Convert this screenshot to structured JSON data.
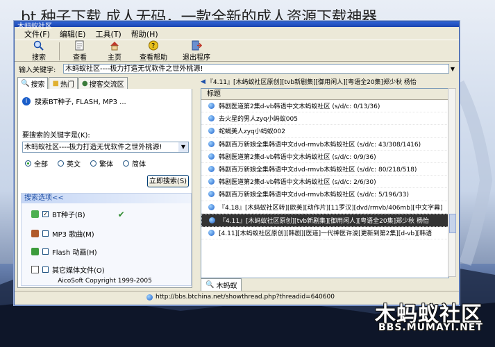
{
  "overlay_title": "bt 种子下载 成人无码，一款全新的成人资源下载神器",
  "window": {
    "title": "木蚂蚁社区"
  },
  "menu": [
    "文件(F)",
    "编辑(E)",
    "工具(T)",
    "帮助(H)"
  ],
  "toolbar": [
    {
      "label": "搜索",
      "icon": "search-icon"
    },
    {
      "label": "查看",
      "icon": "view-icon"
    },
    {
      "label": "主页",
      "icon": "home-icon"
    },
    {
      "label": "查看帮助",
      "icon": "help-icon"
    },
    {
      "label": "退出程序",
      "icon": "exit-icon"
    }
  ],
  "keyword_bar": {
    "label": "输入关键字:",
    "value": "木蚂蚁社区----极力打造无忧软件之世外桃源!"
  },
  "left_tabs": [
    "搜索",
    "热门",
    "搜客交流区"
  ],
  "left_panel": {
    "intro": "搜索BT种子, FLASH, MP3 ...",
    "prompt": "要搜索的关键字是(K):",
    "combo_value": "木蚂蚁社区----极力打造无忧软件之世外桃源!",
    "radios": [
      {
        "label": "全部",
        "selected": true
      },
      {
        "label": "英文",
        "selected": false
      },
      {
        "label": "繁体",
        "selected": false
      },
      {
        "label": "简体",
        "selected": false
      }
    ],
    "search_button": "立即搜索(S)",
    "options_header": "搜索选项<<",
    "options": [
      {
        "label": "BT种子(B)",
        "checked": true,
        "icon": "bt-icon"
      },
      {
        "label": "MP3 歌曲(M)",
        "checked": false,
        "icon": "music-icon"
      },
      {
        "label": "Flash 动画(H)",
        "checked": false,
        "icon": "flash-icon"
      },
      {
        "label": "其它媒体文件(O)",
        "checked": false,
        "icon": "document-icon"
      }
    ],
    "copyright": "AicoSoft Copyright 1999-2005"
  },
  "right_panel": {
    "tab_text": "『4.11』[木蚂蚁社区原创][tvb新剧集][御用闲人][粤语全20集]郑少秋 杨怡",
    "column_header": "标题",
    "results": [
      {
        "title": "韩剧医道第2集d-vb韩语中文木蚂蚁社区 (s/d/c: 0/13/36)",
        "selected": false
      },
      {
        "title": "去火星的男人zyq小蚂蚁005",
        "selected": false
      },
      {
        "title": "蛇蝎美人zyq小蚂蚁002",
        "selected": false
      },
      {
        "title": "韩剧百万新娘全集韩语中文dvd-rmvb木蚂蚁社区 (s/d/c: 43/308/1416)",
        "selected": false
      },
      {
        "title": "韩剧医道第2集d-vb韩语中文木蚂蚁社区 (s/d/c: 0/9/36)",
        "selected": false
      },
      {
        "title": "韩剧百万新娘全集韩语中文dvd-rmvb木蚂蚁社区 (s/d/c: 80/218/518)",
        "selected": false
      },
      {
        "title": "韩剧医道第2集d-vb韩语中文木蚂蚁社区 (s/d/c: 2/6/30)",
        "selected": false
      },
      {
        "title": "韩剧百万新娘全集韩语中文dvd-rmvb木蚂蚁社区 (s/d/c: 5/196/33)",
        "selected": false
      },
      {
        "title": "『4.18』[木蚂蚁社区转][欧美][动作片][11罗汉][dvd/rmvb/406mb][中文字幕]",
        "selected": false
      },
      {
        "title": "『4.11』[木蚂蚁社区原创][tvb新剧集][御用闲人][粤语全20集]郑少秋 杨怡",
        "selected": true
      },
      {
        "title": "[4.11][木蚂蚁社区原创][韩剧][医道]一代神医许浚[更新到第2集][d-vb][韩语",
        "selected": false
      }
    ],
    "bottom_tab": "木蚂蚁"
  },
  "statusbar": {
    "url": "http://bbs.btchina.net/showthread.php?threadid=640600"
  },
  "watermark": {
    "text": "木蚂蚁社区",
    "url": "BBS.MUMAYI.NET"
  },
  "colors": {
    "titlebar": "#2e63d6",
    "window_bg": "#ece9d8",
    "selected_row": "#333333"
  }
}
